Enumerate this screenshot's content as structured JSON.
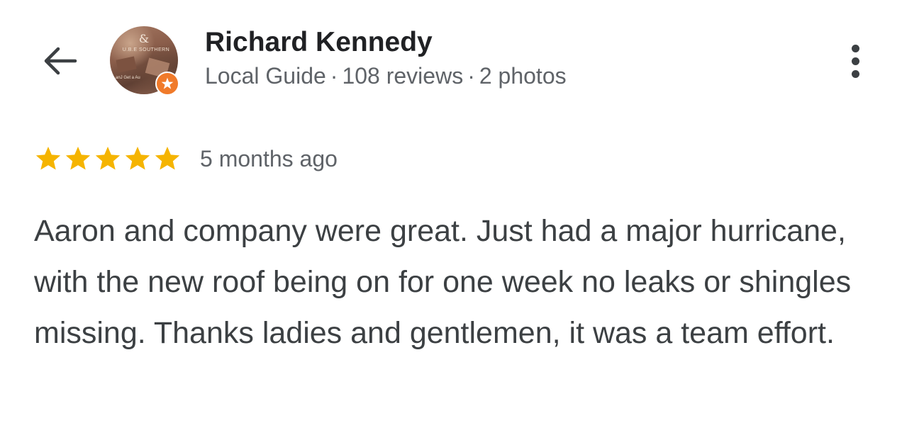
{
  "header": {
    "back_icon": "arrow-left-icon",
    "avatar": {
      "text_amp": "&",
      "text_line1": "U.B.E SOUTHERN",
      "text_line2": "anJ Get a Au",
      "badge_icon": "local-guide-star-icon",
      "badge_color": "#f07a2a"
    },
    "reviewer_name": "Richard Kennedy",
    "meta": {
      "level": "Local Guide",
      "reviews": "108 reviews",
      "photos": "2 photos",
      "separator": "·"
    },
    "more_icon": "more-vertical-icon"
  },
  "review": {
    "rating": 5,
    "rating_max": 5,
    "star_color": "#f5b400",
    "time": "5 months ago",
    "text": "Aaron and company were great. Just had a major hurricane, with the new roof being on for one week no leaks or shingles missing. Thanks ladies and gentlemen, it was a team effort."
  }
}
